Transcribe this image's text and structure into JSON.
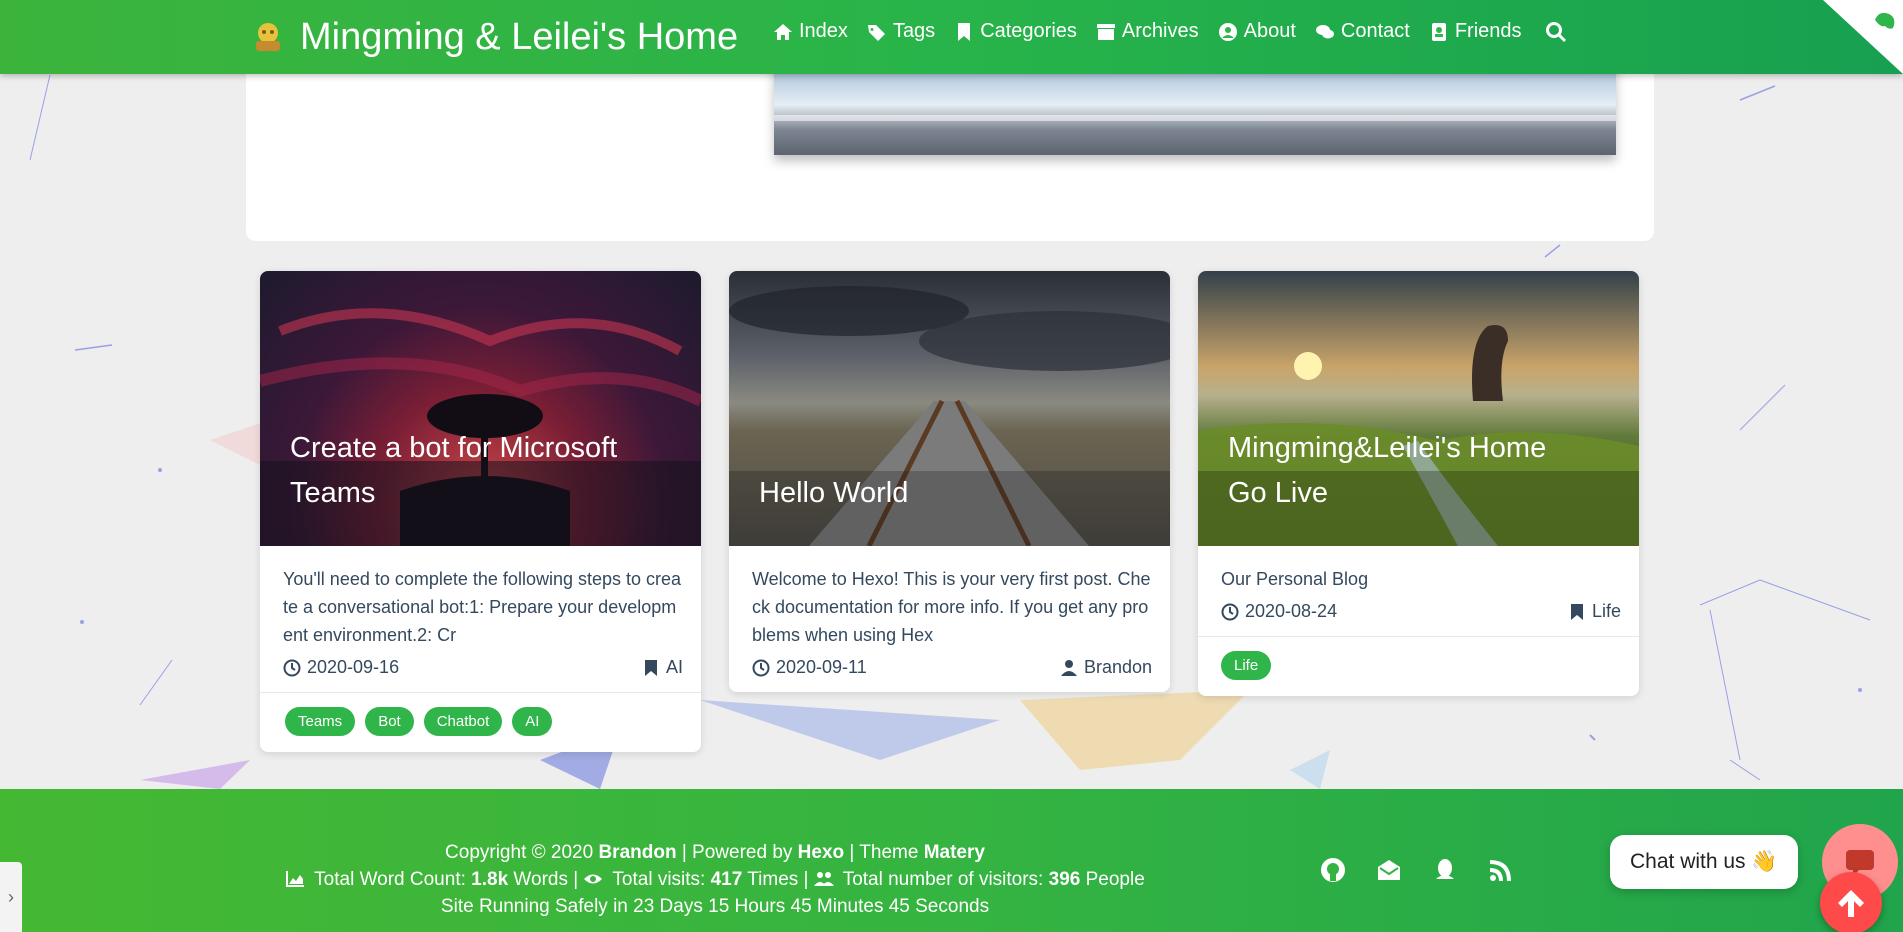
{
  "navbar": {
    "title": "Mingming & Leilei's Home",
    "items": [
      {
        "label": "Index",
        "icon": "home-icon"
      },
      {
        "label": "Tags",
        "icon": "tags-icon"
      },
      {
        "label": "Categories",
        "icon": "bookmark-icon"
      },
      {
        "label": "Archives",
        "icon": "archive-icon"
      },
      {
        "label": "About",
        "icon": "user-circle-icon"
      },
      {
        "label": "Contact",
        "icon": "comments-icon"
      },
      {
        "label": "Friends",
        "icon": "address-book-icon"
      }
    ],
    "search_icon": "search-icon"
  },
  "posts": [
    {
      "title": "Create a bot for Microsoft Teams",
      "summary": "You'll need to complete the following steps to create a conversational bot:1: Prepare your development environment.2: Cr",
      "date": "2020-09-16",
      "meta_right": "AI",
      "meta_right_icon": "bookmark-icon",
      "tags": [
        "Teams",
        "Bot",
        "Chatbot",
        "AI"
      ]
    },
    {
      "title": "Hello World",
      "summary": "Welcome to Hexo! This is your very first post. Check documentation for more info. If you get any problems when using Hex",
      "date": "2020-09-11",
      "meta_right": "Brandon",
      "meta_right_icon": "user-icon",
      "tags": []
    },
    {
      "title": "Mingming&Leilei's Home Go Live",
      "summary": "Our Personal Blog",
      "date": "2020-08-24",
      "meta_right": "Life",
      "meta_right_icon": "bookmark-icon",
      "tags": [
        "Life"
      ]
    }
  ],
  "footer": {
    "copyright_prefix": "Copyright © 2020 ",
    "author": "Brandon",
    "powered_by": " | Powered by ",
    "hexo": "Hexo",
    "theme_text": " | Theme ",
    "theme": "Matery",
    "word_count_label": " Total Word Count: ",
    "word_count": "1.8k",
    "word_unit": " Words | ",
    "visits_label": " Total visits: ",
    "visits": "417",
    "visits_unit": " Times | ",
    "visitors_label": " Total number of visitors: ",
    "visitors": "396",
    "visitors_unit": " People",
    "running": "Site Running Safely in 23 Days 15 Hours 45 Minutes 45 Seconds",
    "social_icons": [
      "github-icon",
      "mail-icon",
      "qq-icon",
      "rss-icon"
    ]
  },
  "chat": {
    "label": "Chat with us",
    "emoji": "👋"
  },
  "side_tab": "›",
  "colors": {
    "accent": "#2fb54a",
    "top_button": "#ff4a4a"
  }
}
